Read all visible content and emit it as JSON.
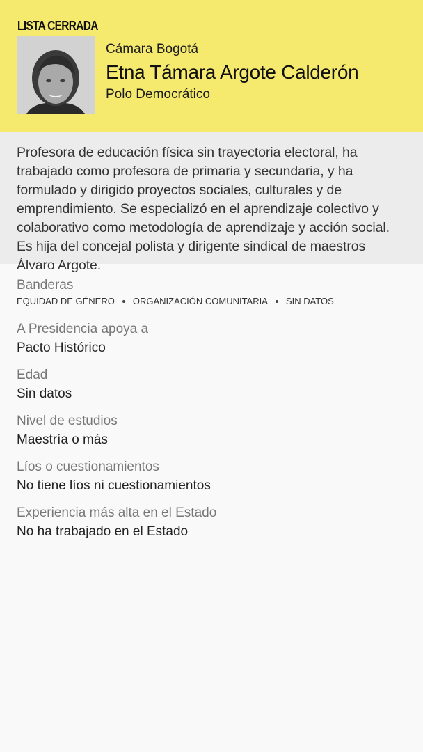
{
  "header": {
    "list_type": "LISTA CERRADA",
    "chamber": "Cámara Bogotá",
    "name": "Etna Támara Argote Calderón",
    "party": "Polo Democrático",
    "background_color": "#f5e96e"
  },
  "bio": "Profesora de educación física sin trayectoria electoral, ha trabajado como profesora de primaria y secundaria, y ha formulado y dirigido proyectos sociales, culturales y de emprendimiento. Se especializó en el aprendizaje colectivo y colaborativo como metodología de aprendizaje y acción social. Es hija del concejal polista y dirigente sindical de maestros Álvaro Argote.",
  "flags": {
    "label": "Banderas",
    "items": [
      "EQUIDAD DE GÉNERO",
      "ORGANIZACIÓN COMUNITARIA",
      "SIN DATOS"
    ]
  },
  "fields": [
    {
      "label": "A Presidencia apoya a",
      "value": "Pacto Histórico"
    },
    {
      "label": "Edad",
      "value": "Sin datos"
    },
    {
      "label": "Nivel de estudios",
      "value": "Maestría o más"
    },
    {
      "label": "Líos o cuestionamientos",
      "value": "No tiene líos ni cuestionamientos"
    },
    {
      "label": "Experiencia más alta en el Estado",
      "value": "No ha trabajado en el Estado"
    }
  ]
}
